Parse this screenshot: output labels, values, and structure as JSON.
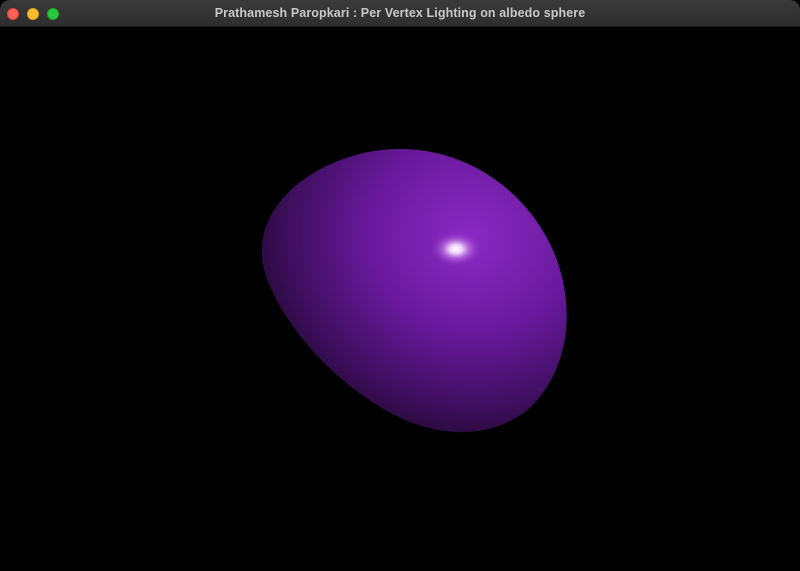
{
  "window": {
    "title": "Prathamesh Paropkari : Per Vertex Lighting on albedo sphere",
    "controls": {
      "close_icon": "close-icon",
      "minimize_icon": "minimize-icon",
      "zoom_icon": "zoom-icon"
    }
  },
  "scene": {
    "background_color": "#000000",
    "sphere_color": "#7a1fb0",
    "sphere_shadow_color": "#12041d",
    "specular_color": "#ffffff"
  }
}
